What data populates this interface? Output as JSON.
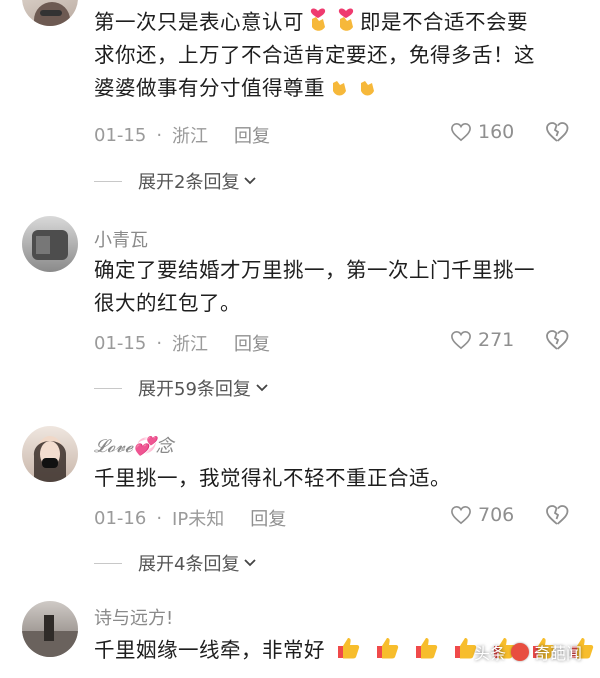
{
  "comments": [
    {
      "username": "",
      "text_line1": "第一次只是表心意认可",
      "text_line1b": "即是不合适不会要",
      "text_line2": "求你还，上万了不合适肯定要还，免得多舌！这",
      "text_line3": "婆婆做事有分寸值得尊重",
      "date": "01-15",
      "location": "浙江",
      "reply_label": "回复",
      "likes": "160",
      "expand_label": "展开2条回复"
    },
    {
      "username": "小青瓦",
      "text_line1": "确定了要结婚才万里挑一，第一次上门千里挑一",
      "text_line2": "很大的红包了。",
      "date": "01-15",
      "location": "浙江",
      "reply_label": "回复",
      "likes": "271",
      "expand_label": "展开59条回复"
    },
    {
      "username": "𝓛𝓸𝓿𝓮💞念",
      "text_line1": "千里挑一，我觉得礼不轻不重正合适。",
      "date": "01-16",
      "location": "IP未知",
      "reply_label": "回复",
      "likes": "706",
      "expand_label": "展开4条回复"
    },
    {
      "username": "诗与远方!",
      "text_line1": "千里姻缘一线牵，非常好",
      "date": "",
      "location": "",
      "reply_label": "",
      "likes": ""
    }
  ],
  "separator": "·",
  "watermark": {
    "left": "头条",
    "right": "奇葩闻"
  },
  "colors": {
    "meta": "#9a9a9a",
    "text": "#1e1e1e",
    "username": "#8a8a8a"
  },
  "icons": [
    "heart-icon",
    "broken-heart-icon",
    "chevron-down-icon",
    "heart-hands-emoji",
    "thumbs-up-emoji"
  ]
}
